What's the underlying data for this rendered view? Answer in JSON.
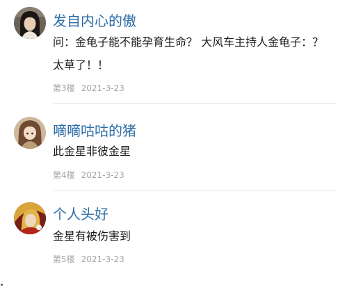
{
  "comments": [
    {
      "username": "发自内心的傲",
      "text": "问：金龟子能不能孕育生命？ 大风车主持人金龟子：？\n太草了！！",
      "floor": "第3楼",
      "date": "2021-3-23",
      "avatar": "avatar-girl-icon"
    },
    {
      "username": "嘀嘀咕咕的猪",
      "text": "此金星非彼金星",
      "floor": "第4楼",
      "date": "2021-3-23",
      "avatar": "avatar-anime-girl-icon"
    },
    {
      "username": "个人头好",
      "text": "金星有被伤害到",
      "floor": "第5楼",
      "date": "2021-3-23",
      "avatar": "avatar-anime-character-icon"
    }
  ],
  "colors": {
    "username": "#2b6da6",
    "text": "#1a1a1a",
    "meta": "#a3a3a3",
    "divider": "#e6e6e6"
  }
}
